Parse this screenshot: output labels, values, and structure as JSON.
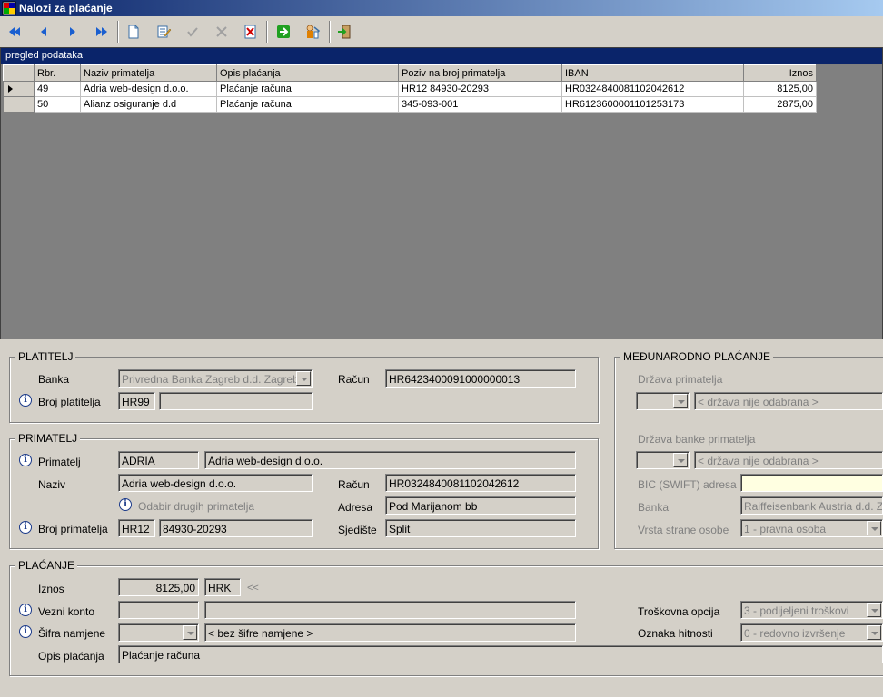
{
  "window": {
    "title": "Nalozi za plaćanje"
  },
  "grid": {
    "caption": "pregled podataka",
    "columns": [
      "Rbr.",
      "Naziv primatelja",
      "Opis plaćanja",
      "Poziv na broj primatelja",
      "IBAN",
      "Iznos"
    ],
    "rows": [
      {
        "rbr": "49",
        "naziv": "Adria web-design d.o.o.",
        "opis": "Plaćanje računa",
        "poziv": "HR12 84930-20293",
        "iban": "HR0324840081102042612",
        "iznos": "8125,00"
      },
      {
        "rbr": "50",
        "naziv": "Alianz osiguranje d.d",
        "opis": "Plaćanje računa",
        "poziv": "345-093-001",
        "iban": "HR6123600001101253173",
        "iznos": "2875,00"
      }
    ]
  },
  "platitelj": {
    "title": "PLATITELJ",
    "banka_label": "Banka",
    "banka_value": "Privredna Banka Zagreb d.d. Zagreb",
    "racun_label": "Račun",
    "racun_value": "HR6423400091000000013",
    "broj_label": "Broj platitelja",
    "broj_model": "HR99",
    "broj_value": ""
  },
  "primatelj": {
    "title": "PRIMATELJ",
    "primatelj_label": "Primatelj",
    "primatelj_code": "ADRIA",
    "primatelj_name": "Adria web-design d.o.o.",
    "naziv_label": "Naziv",
    "naziv_value": "Adria web-design d.o.o.",
    "racun_label": "Račun",
    "racun_value": "HR0324840081102042612",
    "odabir_link": "Odabir drugih primatelja",
    "adresa_label": "Adresa",
    "adresa_value": "Pod Marijanom bb",
    "broj_label": "Broj primatelja",
    "broj_model": "HR12",
    "broj_value": "84930-20293",
    "sjediste_label": "Sjedište",
    "sjediste_value": "Split"
  },
  "medjunarodno": {
    "title": "MEĐUNARODNO PLAĆANJE",
    "drzava_label": "Država primatelja",
    "drzava_value": "< država nije odabrana >",
    "drzava_banke_label": "Država banke primatelja",
    "drzava_banke_value": "< država nije odabrana >",
    "bic_label": "BIC (SWIFT) adresa",
    "bic_value": "",
    "banka_label": "Banka",
    "banka_value": "Raiffeisenbank Austria d.d. Zagr",
    "vrsta_label": "Vrsta strane osobe",
    "vrsta_value": "1 - pravna osoba"
  },
  "placanje": {
    "title": "PLAĆANJE",
    "iznos_label": "Iznos",
    "iznos_value": "8125,00",
    "valuta": "HRK",
    "chevrons": "<<",
    "vezni_label": "Vezni konto",
    "vezni_code": "",
    "vezni_value": "",
    "sifra_label": "Šifra namjene",
    "sifra_value": "< bez šifre namjene >",
    "opis_label": "Opis plaćanja",
    "opis_value": "Plaćanje računa",
    "troskovna_label": "Troškovna opcija",
    "troskovna_value": "3 - podijeljeni  troškovi",
    "hitnost_label": "Oznaka hitnosti",
    "hitnost_value": "0 - redovno izvršenje"
  }
}
